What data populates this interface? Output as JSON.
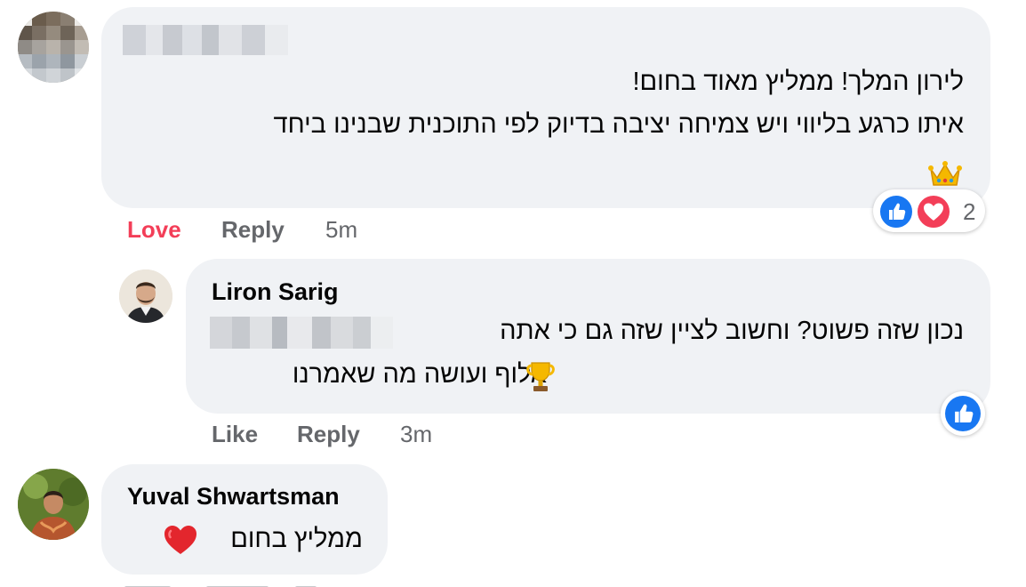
{
  "colors": {
    "bubble_bg": "#f0f2f5",
    "action_text": "#65676b",
    "love_active": "#f33e58",
    "like_blue": "#1877f2"
  },
  "comments": [
    {
      "author_name_redacted": true,
      "lines": [
        "לירון המלך! ממליץ מאוד בחום!",
        "איתו כרגע בליווי ויש צמיחה יציבה בדיוק לפי התוכנית שבנינו ביחד"
      ],
      "emoji": "crown-icon",
      "actions": {
        "reaction": "Love",
        "reply": "Reply",
        "time": "5m"
      },
      "reactions": {
        "icons": [
          "like-icon",
          "love-icon"
        ],
        "count": "2"
      }
    },
    {
      "author": "Liron Sarig",
      "lines": [
        "נכון שזה פשוט? וחשוב לציין שזה גם כי אתה",
        "אלוף ועושה מה שאמרנו"
      ],
      "emoji": "trophy-icon",
      "actions": {
        "reaction": "Like",
        "reply": "Reply",
        "time": "3m"
      },
      "reactions": {
        "icons": [
          "like-icon"
        ]
      }
    },
    {
      "author": "Yuval Shwartsman",
      "lines": [
        "ממליץ בחום"
      ],
      "emoji": "red-heart-icon"
    }
  ]
}
